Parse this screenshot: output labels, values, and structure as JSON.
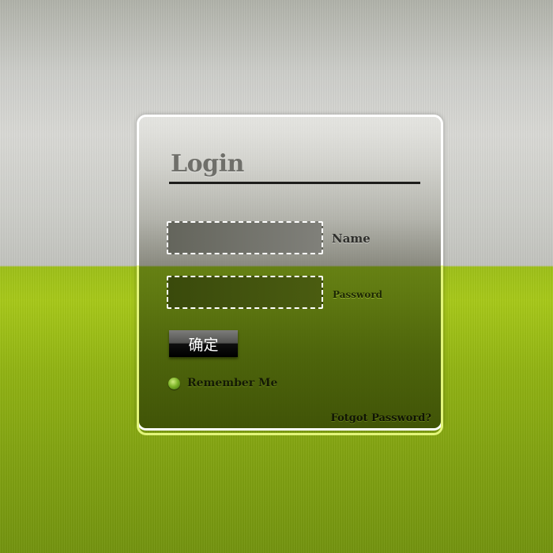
{
  "login": {
    "title": "Login",
    "name_label": "Name",
    "name_value": "",
    "password_label": "Password",
    "password_value": "",
    "submit_label": "确定",
    "remember_label": "Remember Me",
    "forgot_label": "Fotgot Password?"
  },
  "colors": {
    "background_top": "#cdceca",
    "background_bottom": "#9fc11a",
    "panel_border_top": "#ffffff",
    "panel_border_bottom": "#e2f57a",
    "field_border": "#ffffff",
    "button": "#000000"
  },
  "icons": {
    "remember": "green-radio-dot-icon"
  }
}
